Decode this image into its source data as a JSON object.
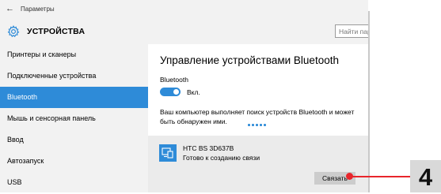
{
  "window": {
    "app_title": "Параметры",
    "page_title": "УСТРОЙСТВА",
    "search_placeholder": "Найти пар",
    "back_icon": "back-arrow-icon",
    "header_icon": "gear-icon"
  },
  "sidebar": {
    "items": [
      {
        "label": "Принтеры и сканеры",
        "selected": false
      },
      {
        "label": "Подключенные устройства",
        "selected": false
      },
      {
        "label": "Bluetooth",
        "selected": true
      },
      {
        "label": "Мышь и сенсорная панель",
        "selected": false
      },
      {
        "label": "Ввод",
        "selected": false
      },
      {
        "label": "Автозапуск",
        "selected": false
      },
      {
        "label": "USB",
        "selected": false
      }
    ]
  },
  "main": {
    "title": "Управление устройствами Bluetooth",
    "bluetooth_label": "Bluetooth",
    "toggle_state": "Вкл.",
    "toggle_on": true,
    "description": "Ваш компьютер выполняет поиск устройств Bluetooth и может быть обнаружен ими.",
    "device": {
      "name": "HTC BS 3D637B",
      "status": "Готово к созданию связи",
      "icon": "device-icon"
    },
    "connect_label": "Связать"
  },
  "annotation": {
    "number": "4"
  },
  "colors": {
    "accent": "#2e8bd8",
    "sidebar_bg": "#f2f2f2",
    "device_row_bg": "#ebebeb",
    "callout_red": "#e8252b",
    "badge_bg": "#d9d9d9"
  }
}
